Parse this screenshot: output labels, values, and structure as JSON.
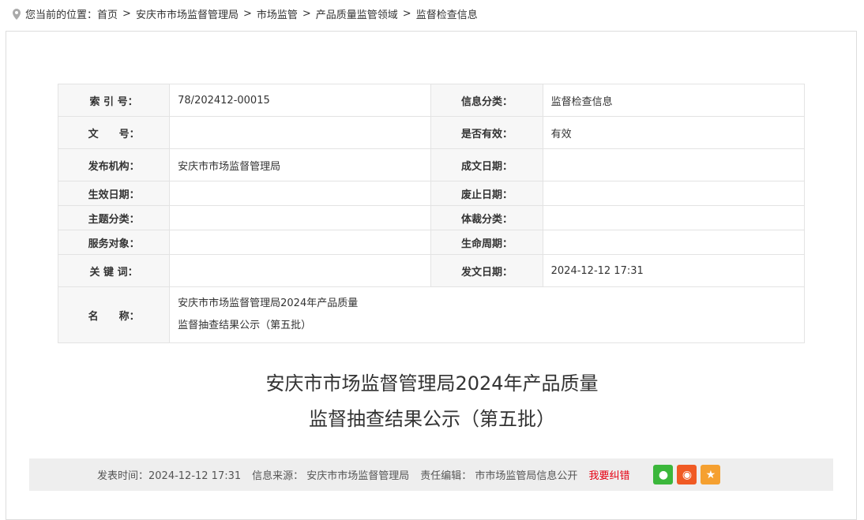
{
  "breadcrumb": {
    "prefix": "您当前的位置：",
    "items": [
      "首页",
      "安庆市市场监督管理局",
      "市场监管",
      "产品质量监管领域",
      "监督检查信息"
    ],
    "sep": ">"
  },
  "meta": [
    {
      "l1": "索 引 号：",
      "v1": "78/202412-00015",
      "l2": "信息分类：",
      "v2": "监督检查信息"
    },
    {
      "l1": "文　　号：",
      "v1": "",
      "l2": "是否有效：",
      "v2": "有效"
    },
    {
      "l1": "发布机构：",
      "v1": "安庆市市场监督管理局",
      "l2": "成文日期：",
      "v2": ""
    },
    {
      "l1": "生效日期：",
      "v1": "",
      "l2": "废止日期：",
      "v2": ""
    },
    {
      "l1": "主题分类：",
      "v1": "",
      "l2": "体裁分类：",
      "v2": ""
    },
    {
      "l1": "服务对象：",
      "v1": "",
      "l2": "生命周期：",
      "v2": ""
    },
    {
      "l1": "关 键 词：",
      "v1": "",
      "l2": "发文日期：",
      "v2": "2024-12-12 17:31"
    }
  ],
  "name_label": "名　　称：",
  "name_line1": "安庆市市场监督管理局2024年产品质量",
  "name_line2": "监督抽查结果公示（第五批）",
  "title_line1": "安庆市市场监督管理局2024年产品质量",
  "title_line2": "监督抽查结果公示（第五批）",
  "footer": {
    "time": "发表时间：2024-12-12 17:31",
    "source": "信息来源： 安庆市市场监督管理局",
    "editor": "责任编辑： 市市场监管局信息公开",
    "report": "我要纠错",
    "report_color": "#e60012"
  },
  "share": [
    {
      "icon": "wechat-icon",
      "color": "#3bb73b"
    },
    {
      "icon": "weibo-icon",
      "color": "#f05a24"
    },
    {
      "icon": "favorite-icon",
      "color": "#f5a030"
    }
  ]
}
